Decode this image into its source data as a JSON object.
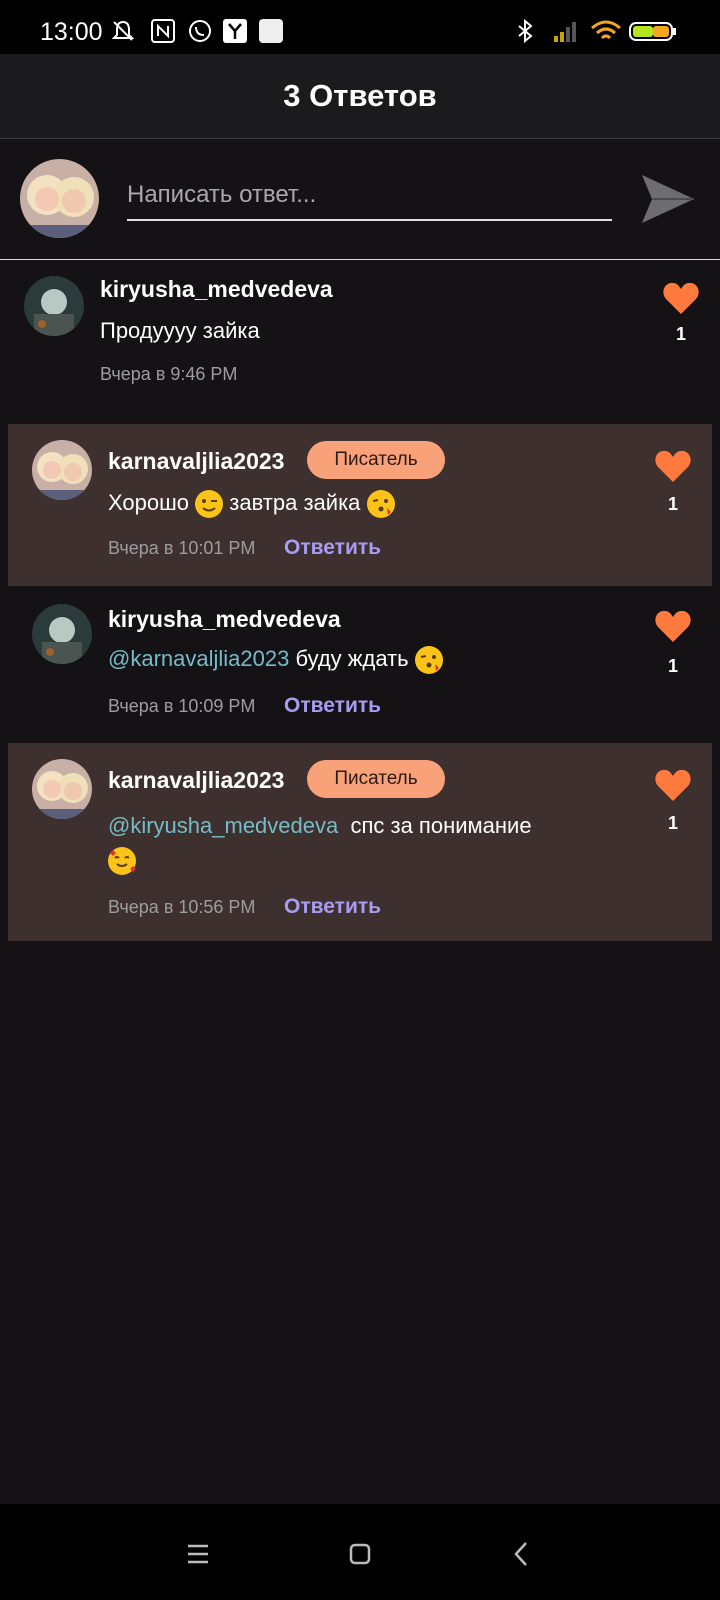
{
  "status_bar": {
    "time": "13:00"
  },
  "header": {
    "title": "3 Ответов"
  },
  "compose": {
    "placeholder": "Написать ответ..."
  },
  "comments": [
    {
      "username": "kiryusha_medvedeva",
      "badge": "",
      "text": "Продуууу зайка",
      "mention": "",
      "timestamp": "Вчера в 9:46 PM",
      "reply_label": "",
      "likes": "1"
    },
    {
      "username": "karnavaljlia2023",
      "badge": "Писатель",
      "text": "Хорошо",
      "text2": "завтра зайка",
      "mention": "",
      "timestamp": "Вчера в 10:01 PM",
      "reply_label": "Ответить",
      "likes": "1"
    },
    {
      "username": "kiryusha_medvedeva",
      "badge": "",
      "mention": "@karnavaljlia2023",
      "text": "буду ждать",
      "timestamp": "Вчера в 10:09 PM",
      "reply_label": "Ответить",
      "likes": "1"
    },
    {
      "username": "karnavaljlia2023",
      "badge": "Писатель",
      "mention": "@kiryusha_medvedeva",
      "text": "спс за понимание",
      "timestamp": "Вчера в 10:56 PM",
      "reply_label": "Ответить",
      "likes": "1"
    }
  ],
  "colors": {
    "accent": "#ff7a3c",
    "badge_bg": "#f9a27a",
    "mention": "#75bcc7",
    "reply": "#a89cf0",
    "highlight_bg": "#3e302f"
  },
  "icons": [
    "muted-bell-icon",
    "nfc-icon",
    "whatsapp-icon",
    "yandex-icon",
    "bluetooth-icon",
    "signal-icon",
    "wifi-icon",
    "battery-icon",
    "send-icon",
    "heart-icon",
    "menu-icon",
    "home-icon",
    "back-icon"
  ]
}
